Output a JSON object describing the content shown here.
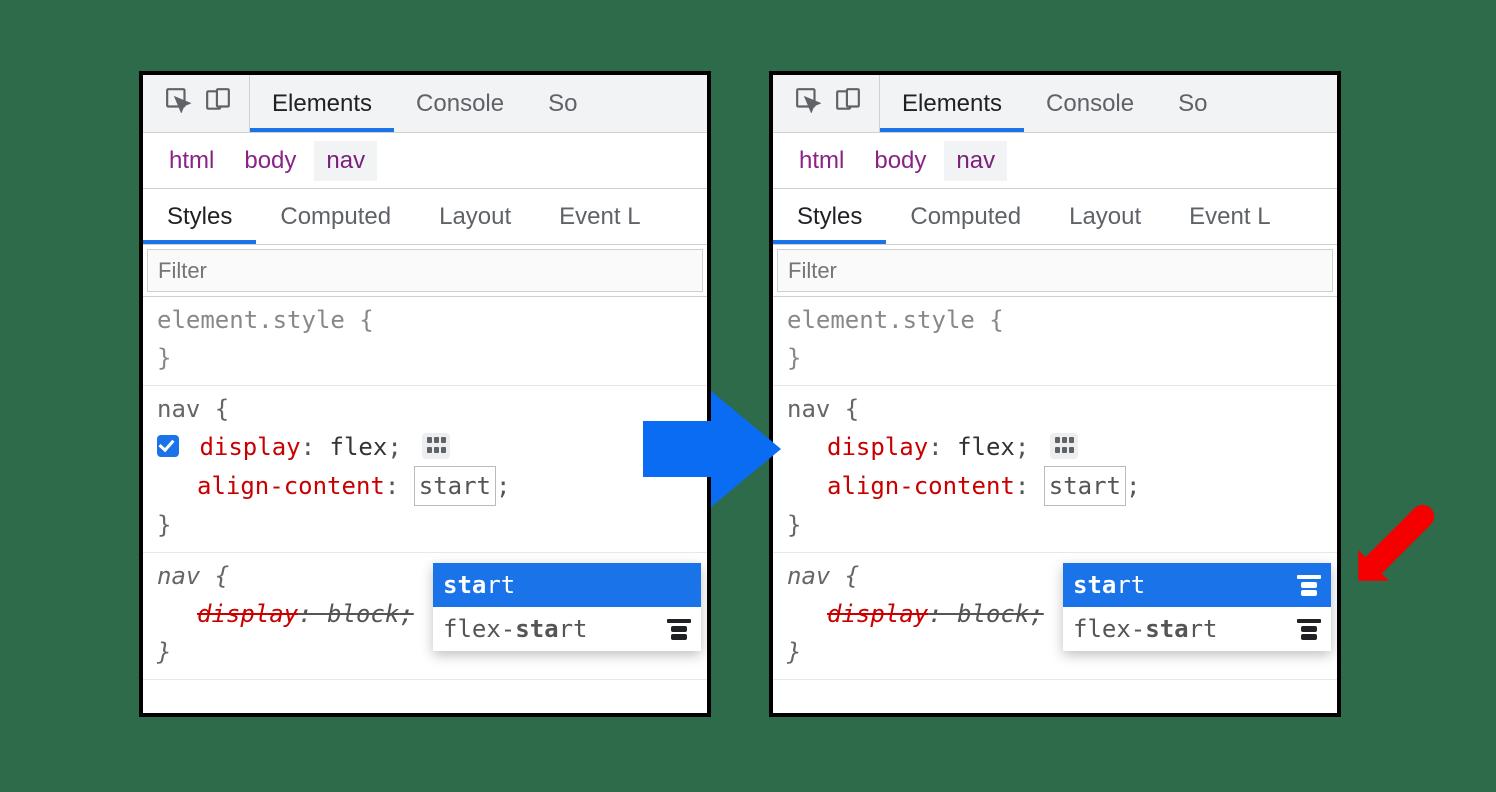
{
  "topTabs": {
    "elements": "Elements",
    "console": "Console",
    "sources": "So"
  },
  "crumbs": {
    "html": "html",
    "body": "body",
    "nav": "nav"
  },
  "subTabs": {
    "styles": "Styles",
    "computed": "Computed",
    "layout": "Layout",
    "events": "Event L"
  },
  "filterPlaceholder": "Filter",
  "elementStyle": {
    "open": "element.style {",
    "close": "}"
  },
  "navRule": {
    "open": "nav {",
    "displayProp": "display",
    "displayVal": "flex",
    "alignProp": "align-content",
    "alignValTyped": "start",
    "close": "}"
  },
  "overridden": {
    "open": "nav {",
    "displayProp": "display",
    "displayVal": "block",
    "close": "}"
  },
  "popupLeft": {
    "rows": [
      {
        "bold": "sta",
        "rest": "rt",
        "hasIcon": false,
        "selected": true
      },
      {
        "bold": "sta",
        "rest": "rt",
        "prefix": "flex-",
        "hasIcon": true,
        "selected": false
      }
    ]
  },
  "popupRight": {
    "rows": [
      {
        "bold": "sta",
        "rest": "rt",
        "hasIcon": true,
        "selected": true
      },
      {
        "bold": "sta",
        "rest": "rt",
        "prefix": "flex-",
        "hasIcon": true,
        "selected": false
      }
    ]
  }
}
